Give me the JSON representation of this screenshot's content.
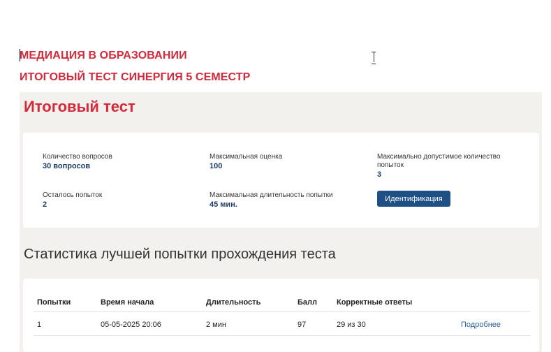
{
  "headings": {
    "line1": "МЕДИАЦИЯ В ОБРАЗОВАНИИ",
    "line2": "ИТОГОВЫЙ ТЕСТ СИНЕРГИЯ 5 СЕМЕСТР"
  },
  "test": {
    "title": "Итоговый тест",
    "info": {
      "questions_label": "Количество вопросов",
      "questions_value": "30 вопросов",
      "max_score_label": "Максимальная оценка",
      "max_score_value": "100",
      "max_attempts_label": "Максимально допустимое количество попыток",
      "max_attempts_value": "3",
      "remaining_label": "Осталось попыток",
      "remaining_value": "2",
      "max_duration_label": "Максимальная длительность попытки",
      "max_duration_value": "45 мин."
    },
    "identify_button": "Идентификация"
  },
  "stats": {
    "title": "Статистика лучшей попытки прохождения теста",
    "columns": [
      "Попытки",
      "Время начала",
      "Длительность",
      "Балл",
      "Корректные ответы"
    ],
    "rows": [
      {
        "attempt": "1",
        "start_time": "05-05-2025 20:06",
        "duration": "2 мин",
        "score": "97",
        "correct": "29 из 30",
        "link": "Подробнее"
      }
    ]
  },
  "colors": {
    "accent_red": "#d42a3c",
    "primary_blue": "#1e4f85",
    "value_blue": "#1e3d6b",
    "link_blue": "#2a62a8",
    "panel_bg": "#f2f1ee"
  },
  "icons": [
    "text-cursor-icon",
    "ibeam-cursor-icon"
  ]
}
